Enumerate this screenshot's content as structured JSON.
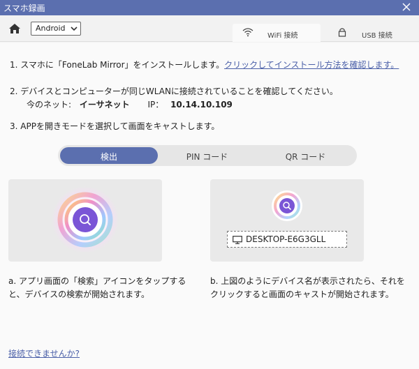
{
  "window": {
    "title": "スマホ録画"
  },
  "toolbar": {
    "os_select": "Android",
    "tabs": [
      {
        "label": "WiFi 接続",
        "icon": "wifi-icon",
        "active": true
      },
      {
        "label": "USB 接続",
        "icon": "lock-icon",
        "active": false
      }
    ]
  },
  "steps": {
    "step1_text": "1. スマホに「FoneLab Mirror」をインストールします。",
    "step1_link": "クリックしてインストール方法を確認します。",
    "step2_text": "2. デバイスとコンピューターが同じWLANに接続されていることを確認してください。",
    "net_label": "今のネット:",
    "net_value": "イーサネット",
    "ip_label": "IP：",
    "ip_value": "10.14.10.109",
    "step3_text": "3. APPを開きモードを選択して画面をキャストします。"
  },
  "modes": [
    {
      "label": "検出",
      "active": true
    },
    {
      "label": "PIN コード",
      "active": false
    },
    {
      "label": "QR コード",
      "active": false
    }
  ],
  "detect": {
    "device_name": "DESKTOP-E6G3GLL",
    "desc_a": "a. アプリ画面の「検索」アイコンをタップすると、デバイスの検索が開始されます。",
    "desc_b": "b. 上図のようにデバイス名が表示されたら、それをクリックすると画面のキャストが開始されます。"
  },
  "help_link": "接続できませんか?",
  "colors": {
    "accent": "#5b6faf",
    "link": "#4a5fa8",
    "search_purple": "#7a55d6"
  }
}
